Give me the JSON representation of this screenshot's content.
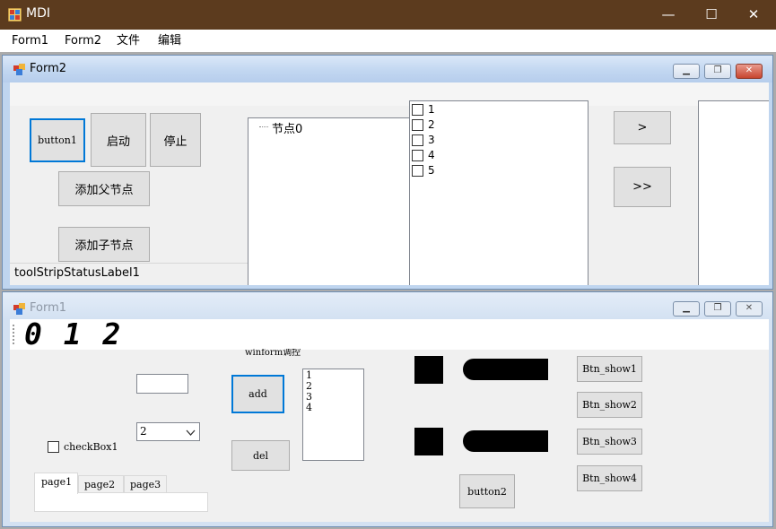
{
  "window": {
    "title": "MDI",
    "minimize": "—",
    "maximize": "☐",
    "close": "✕"
  },
  "menu": [
    "Form1",
    "Form2",
    "文件",
    "编辑"
  ],
  "form2": {
    "title": "Form2",
    "button1": "button1",
    "start": "启动",
    "stop": "停止",
    "add_parent": "添加父节点",
    "add_child": "添加子节点",
    "status_label": "toolStripStatusLabel1",
    "tree_node": "节点0",
    "checklist": [
      "1",
      "2",
      "3",
      "4",
      "5"
    ],
    "move_one": ">",
    "move_all": ">>"
  },
  "form1": {
    "title": "Form1",
    "lcd": "0 1 2",
    "group_label": "winform调控",
    "combo_value": "2",
    "checkbox_label": "checkBox1",
    "add": "add",
    "del": "del",
    "listbox": [
      "1",
      "2",
      "3",
      "4"
    ],
    "show_buttons": [
      "Btn_show1",
      "Btn_show2",
      "Btn_show3",
      "Btn_show4"
    ],
    "button2": "button2",
    "tabs": [
      "page1",
      "page2",
      "page3"
    ],
    "active_tab": "page1"
  },
  "colors": {
    "titlebar": "#5c3b1e",
    "focus_border": "#0078d7",
    "child_frame": "#bfd5ef"
  }
}
